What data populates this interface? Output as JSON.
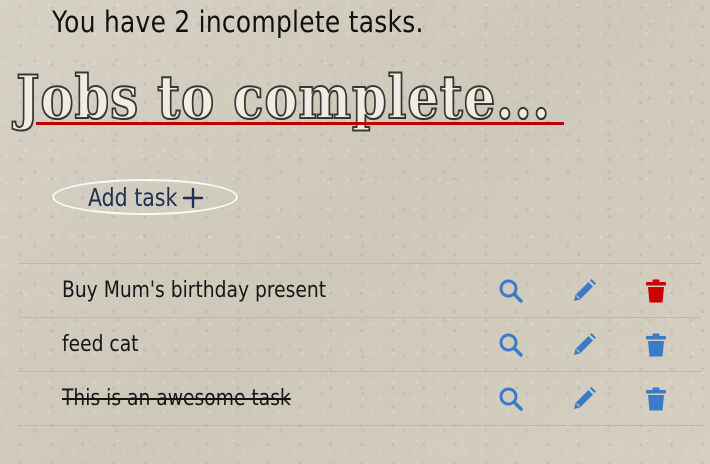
{
  "header": {
    "subtitle": "You have 2 incomplete tasks.",
    "title": "Jobs to complete..."
  },
  "add_task": {
    "label": "Add task"
  },
  "colors": {
    "view_icon": "#3a7bc8",
    "edit_icon": "#3a7bc8",
    "delete_icon_default": "#3a7bc8",
    "delete_icon_active": "#cc0000",
    "title_underline": "#c00000",
    "add_task_text": "#1f2f4f"
  },
  "tasks": [
    {
      "text": "Buy Mum's birthday present",
      "completed": false,
      "view_icon": "search-icon",
      "edit_icon": "pencil-icon",
      "delete_icon": "trash-icon",
      "delete_highlighted": true
    },
    {
      "text": "feed cat",
      "completed": false,
      "view_icon": "search-icon",
      "edit_icon": "pencil-icon",
      "delete_icon": "trash-icon",
      "delete_highlighted": false
    },
    {
      "text": "This is an awesome task",
      "completed": true,
      "view_icon": "search-icon",
      "edit_icon": "pencil-icon",
      "delete_icon": "trash-icon",
      "delete_highlighted": false
    }
  ]
}
